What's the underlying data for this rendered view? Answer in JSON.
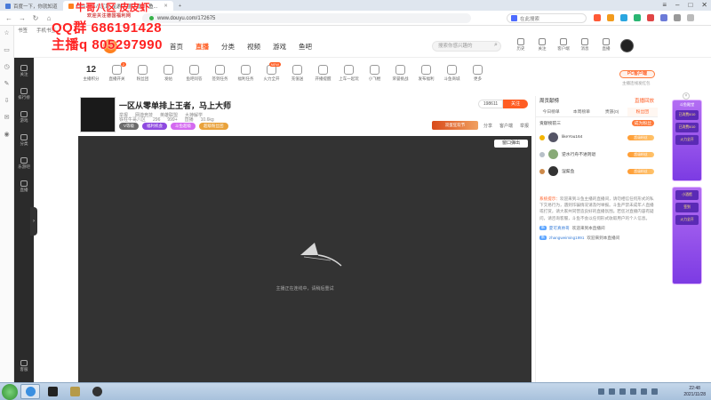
{
  "browser": {
    "tabs": [
      {
        "label": "百度一下，你就知道",
        "active": false
      },
      {
        "label": "铁柱牛哥八区跳 星游联盟直播_斗鱼...",
        "active": true
      }
    ],
    "new_tab": "+",
    "url": "www.douyu.com/172675",
    "search_placeholder": "在此搜索",
    "bookmarks": [
      "书签",
      "手机书签"
    ],
    "window_controls": [
      "≡",
      "–",
      "□",
      "✕"
    ],
    "nav": [
      "←",
      "→",
      "↻",
      "⌂"
    ]
  },
  "watermark": {
    "line1": "牛哥八区 皮皮虾",
    "line2": "QQ群 686191428",
    "line3": "主播q 805297990",
    "sub": "欢迎关注德国福利网"
  },
  "douyu": {
    "nav": [
      {
        "label": "首页",
        "active": false
      },
      {
        "label": "直播",
        "active": true
      },
      {
        "label": "分类",
        "active": false
      },
      {
        "label": "视频",
        "active": false
      },
      {
        "label": "游戏",
        "active": false
      },
      {
        "label": "鱼吧",
        "active": false
      }
    ],
    "search_placeholder": "搜索你感兴趣的",
    "header_icons": [
      "历史",
      "关注",
      "客户端",
      "消息",
      "直播"
    ],
    "categories": [
      {
        "label": "主播积分",
        "value": "12"
      },
      {
        "label": "直播开关",
        "badge": "2"
      },
      {
        "label": "粉丝团"
      },
      {
        "label": "发帖"
      },
      {
        "label": "鱼吧问答"
      },
      {
        "label": "签到任务"
      },
      {
        "label": "福利任务"
      },
      {
        "label": "火力全开",
        "badge": "NEW"
      },
      {
        "label": "充值送"
      },
      {
        "label": "开播提醒"
      },
      {
        "label": "上车一起玩"
      },
      {
        "label": "小飞棍"
      },
      {
        "label": "荣誉挑战"
      },
      {
        "label": "发布福利"
      },
      {
        "label": "斗鱼商城"
      },
      {
        "label": "更多"
      }
    ],
    "pc_button": "PC客户端",
    "pc_sub": "主播连线发红包",
    "room": {
      "title": "一区从零单排上王者，马上大师",
      "meta": [
        "举报",
        "网游竞技",
        "英雄联盟",
        "大神解学"
      ],
      "anchor_name": "铁柱牛哥八区",
      "stats": [
        "296",
        "999+",
        "直播",
        "10.6kg"
      ],
      "tags": [
        "V等级",
        "福利机会",
        "斗鱼超级",
        "超级粉丝团"
      ],
      "follow_count": "198611",
      "follow_label": "关注",
      "promo": "双蛋狂欢节",
      "actions": [
        "分享",
        "客户端",
        "举报"
      ]
    },
    "player": {
      "message": "主播正在连线中，请稍后重试",
      "popout": "窗口弹出"
    },
    "chat": {
      "head_left": "周贡献榜",
      "head_right": "直播回放",
      "tabs": [
        {
          "label": "今日榜单",
          "active": false
        },
        {
          "label": "本周榜单",
          "active": false
        },
        {
          "label": "贵族(0)",
          "active": false
        },
        {
          "label": "粉丝团",
          "active": true
        }
      ],
      "rank_title": "贡献榜前三",
      "rank_btn": "成为粉丝",
      "ranks": [
        {
          "name": "likeYou164",
          "level": "超级粉丝"
        },
        {
          "name": "逆水行舟不进则退",
          "level": "超级粉丝"
        },
        {
          "name": "涅槃鱼",
          "level": "超级粉丝"
        }
      ],
      "sys_label": "系统提示：",
      "sys_text": "欢迎来到斗鱼主播的直播间，请勿相信任何形式的私下交易行为，遇到诈骗情况请及时举报。斗鱼严禁未成年人直播或打赏，请大家共同营造良好的直播氛围。若您对直播内容有疑问，请咨询客服，斗鱼不会以任何形式收取用户的个人信息。",
      "messages": [
        {
          "badge": "新",
          "user": "夏可真帅哥",
          "text": "欢迎来到本直播间"
        },
        {
          "badge": "新",
          "user": "zhangweiming1991",
          "text": "欢迎来到本直播间"
        }
      ]
    },
    "event": {
      "title": "斗鱼殿堂",
      "items": [
        "已消费0/10",
        "已消费0/10",
        "火力全开",
        "小酒馆",
        "签到",
        "火力全开"
      ]
    },
    "sidebar": [
      "关注",
      "排行榜",
      "游戏",
      "分类",
      "乐游吧",
      "直播",
      "客服"
    ]
  },
  "taskbar": {
    "time": "22:48",
    "date": "2021/11/28"
  },
  "colors": {
    "accent": "#ff5d23",
    "player_bg": "#333333",
    "watermark": "#ff2222",
    "event_purple": "#7c3be3"
  }
}
